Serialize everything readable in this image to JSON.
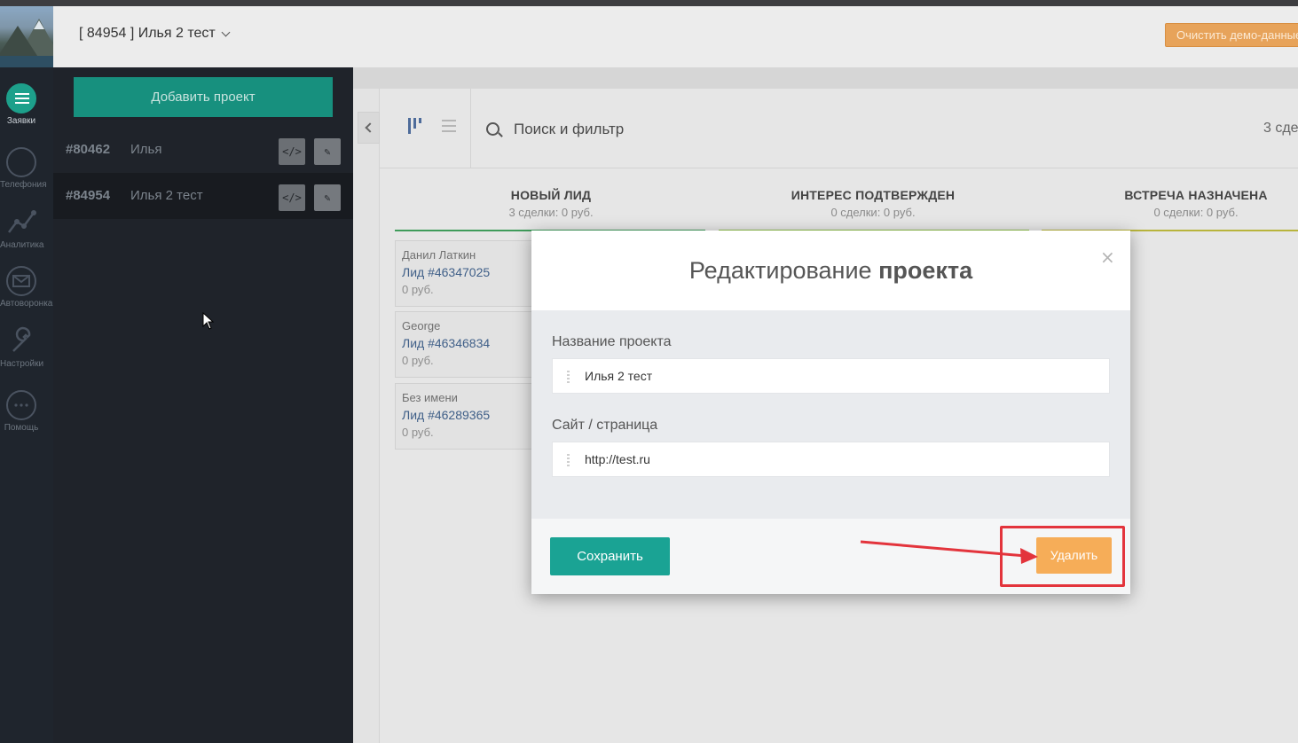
{
  "header": {
    "project_title": "[ 84954 ] Илья 2 тест",
    "demo_button": "Очистить демо-данные"
  },
  "rail": {
    "items": [
      {
        "label": "Заявки",
        "icon": "list-icon",
        "active": true
      },
      {
        "label": "Телефония",
        "icon": "phone-icon"
      },
      {
        "label": "Аналитика",
        "icon": "analytics-icon"
      },
      {
        "label": "Автоворонка",
        "icon": "mail-icon"
      },
      {
        "label": "Настройки",
        "icon": "wrench-icon"
      },
      {
        "label": "Помощь",
        "icon": "chat-icon"
      }
    ]
  },
  "panel": {
    "add_button": "Добавить проект",
    "projects": [
      {
        "id": "#80462",
        "name": "Илья"
      },
      {
        "id": "#84954",
        "name": "Илья 2 тест"
      }
    ],
    "code_glyph": "</>",
    "edit_glyph": "✎"
  },
  "board": {
    "search_placeholder": "Поиск и фильтр",
    "deals_count": "3 сде",
    "columns": [
      {
        "title": "НОВЫЙ ЛИД",
        "summary": "3 сделки: 0 руб.",
        "color": "#3f9c5b"
      },
      {
        "title": "ИНТЕРЕС ПОДТВЕРЖДЕН",
        "summary": "0 сделки: 0 руб.",
        "color": "#8fbf4a"
      },
      {
        "title": "ВСТРЕЧА НАЗНАЧЕНА",
        "summary": "0 сделки: 0 руб.",
        "color": "#b8b43c"
      }
    ],
    "cards": [
      {
        "name": "Данил Латкин",
        "lead": "Лид #46347025",
        "price": "0 руб."
      },
      {
        "name": "George",
        "lead": "Лид #46346834",
        "price": "0 руб."
      },
      {
        "name": "Без имени",
        "lead": "Лид #46289365",
        "price": "0 руб."
      }
    ]
  },
  "modal": {
    "title_light": "Редактирование",
    "title_bold": "проекта",
    "close": "×",
    "name_label": "Название проекта",
    "name_value": "Илья 2 тест",
    "site_label": "Сайт / страница",
    "site_value": "http://test.ru",
    "save": "Сохранить",
    "delete": "Удалить"
  },
  "colors": {
    "accent": "#1aa394",
    "delete": "#f6ad58",
    "annotation": "#e3343c"
  }
}
